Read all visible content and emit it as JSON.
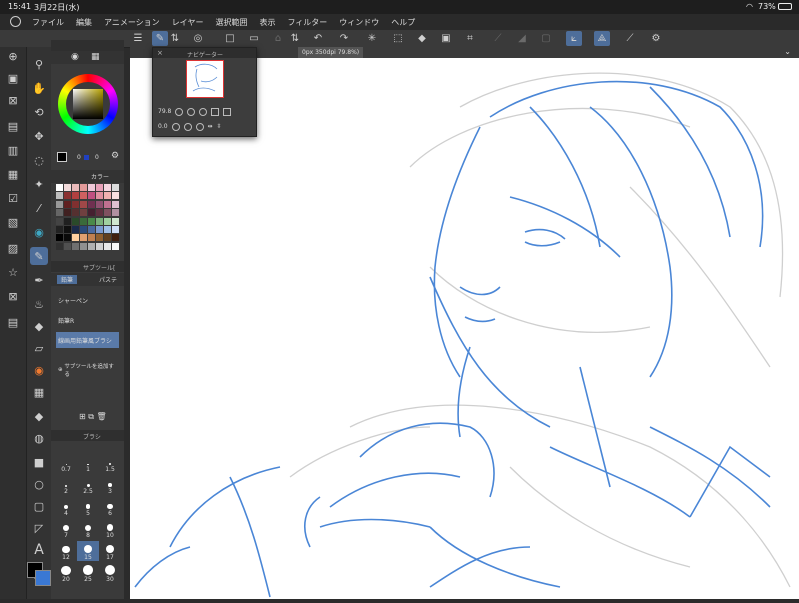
{
  "status": {
    "time": "15:41",
    "date": "3月22日(水)",
    "battery": "73%"
  },
  "menu": [
    "ファイル",
    "編集",
    "アニメーション",
    "レイヤー",
    "選択範囲",
    "表示",
    "フィルター",
    "ウィンドウ",
    "ヘルプ"
  ],
  "navigator": {
    "title": "ナビゲーター",
    "zoom": "79.8",
    "rotation": "0.0"
  },
  "doc_tab": {
    "label": "0px 350dpi 79.8%)"
  },
  "color_panel": {
    "values": [
      "0",
      "0"
    ],
    "tab": "カラー"
  },
  "subtool": {
    "header": "サブツール[",
    "tabs": [
      "鉛筆",
      "パステ"
    ],
    "items": [
      "シャーペン",
      "鉛筆R",
      "線画用鉛筆風ブラシ"
    ],
    "selected_index": 2,
    "add_label": "サブツールを追加する"
  },
  "brush_size": {
    "header": "ブラシ",
    "sizes": [
      "0.7",
      "1",
      "1.5",
      "2",
      "2.5",
      "3",
      "4",
      "5",
      "6",
      "7",
      "8",
      "10",
      "12",
      "15",
      "17",
      "20",
      "25",
      "30"
    ],
    "selected": "15"
  },
  "colors": {
    "accent": "#4e6e9a",
    "main_color": "#000000",
    "sub_color": "#3a78d4"
  }
}
